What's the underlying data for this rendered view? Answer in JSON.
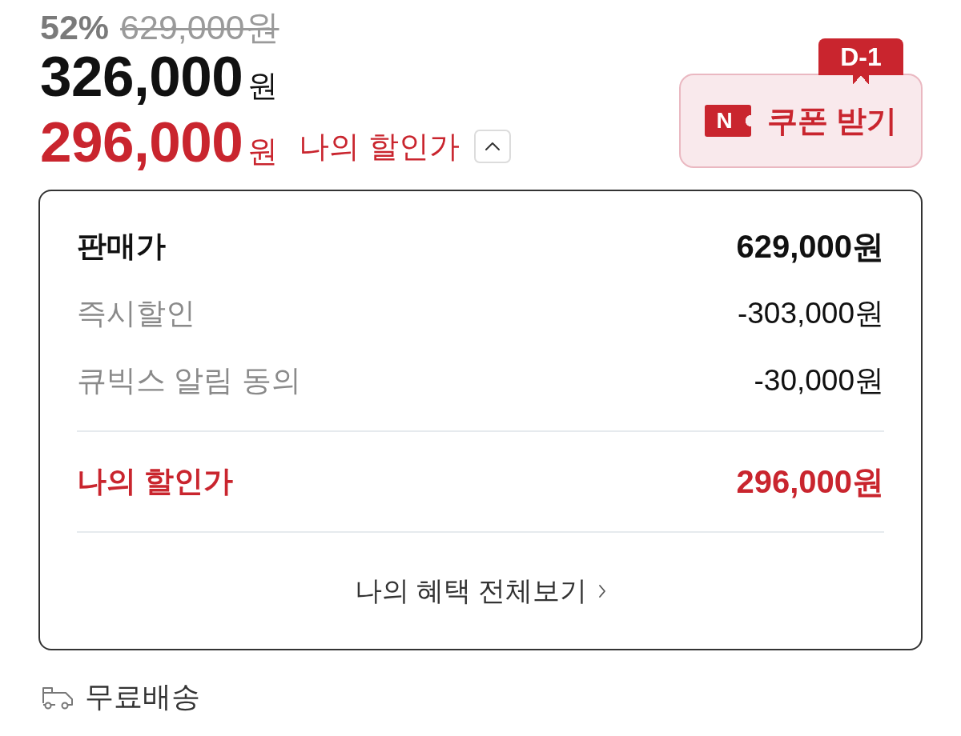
{
  "price": {
    "discount_rate": "52%",
    "original_price": "629,000원",
    "sale_price": {
      "amount": "326,000",
      "unit": "원"
    },
    "my_price": {
      "amount": "296,000",
      "unit": "원",
      "label": "나의 할인가"
    },
    "breakdown_expanded": true
  },
  "coupon_button": {
    "badge": "D-1",
    "icon_text": "N",
    "label": "쿠폰 받기"
  },
  "breakdown": {
    "rows": [
      {
        "kind": "base",
        "label": "판매가",
        "value": "629,000원"
      },
      {
        "kind": "discount",
        "label": "즉시할인",
        "value": "-303,000원"
      },
      {
        "kind": "discount",
        "label": "큐빅스 알림 동의",
        "value": "-30,000원"
      },
      {
        "kind": "total",
        "label": "나의 할인가",
        "value": "296,000원"
      }
    ],
    "link": "나의 혜택 전체보기"
  },
  "shipping": {
    "label": "무료배송"
  }
}
